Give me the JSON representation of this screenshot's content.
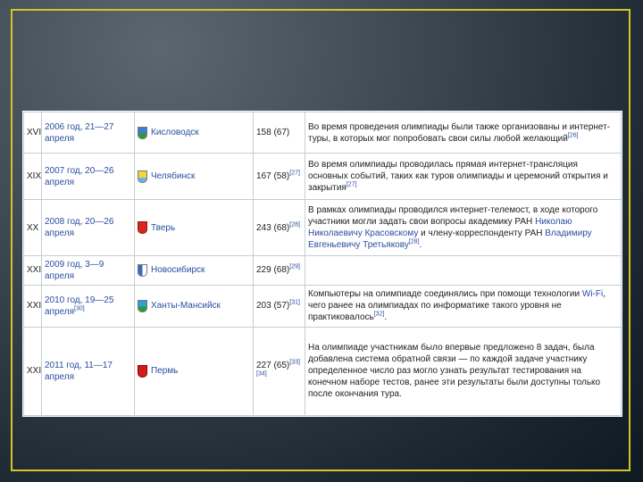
{
  "rows": [
    {
      "num": "XVII",
      "date": "2006 год, 21—27 апреля",
      "date_ref": "",
      "city": "Кисловодск",
      "crest_icon": "kislovodsk-crest-icon",
      "participants": "158 (67)",
      "participants_ref": "",
      "note_parts": [
        {
          "t": "Во время проведения олимпиады были также организованы и интернет-туры, в которых мог попробовать свои силы любой желающий",
          "link": false
        },
        {
          "t": "[26]",
          "sup": true
        }
      ]
    },
    {
      "num": "XIX",
      "date": "2007 год, 20—26 апреля",
      "date_ref": "",
      "city": "Челябинск",
      "crest_icon": "chelyabinsk-crest-icon",
      "participants": "167 (58)",
      "participants_ref": "[27]",
      "note_parts": [
        {
          "t": "Во время олимпиады проводилась прямая интернет-трансляция основных событий, таких как туров олимпиады и церемоний открытия и закрытия",
          "link": false
        },
        {
          "t": "[27]",
          "sup": true
        }
      ]
    },
    {
      "num": "XX",
      "date": "2008 год, 20—26 апреля",
      "date_ref": "",
      "city": "Тверь",
      "crest_icon": "tver-crest-icon",
      "participants": "243 (68)",
      "participants_ref": "[28]",
      "note_parts": [
        {
          "t": "В рамках олимпиады проводился интернет-телемост, в ходе которого участники могли задать свои вопросы академику РАН ",
          "link": false
        },
        {
          "t": "Николаю Николаевичу Красовскому",
          "link": true
        },
        {
          "t": " и члену-корреспонденту РАН ",
          "link": false
        },
        {
          "t": "Владимиру Евгеньевичу Третьякову",
          "link": true
        },
        {
          "t": "[28]",
          "sup": true
        },
        {
          "t": ".",
          "link": false
        }
      ]
    },
    {
      "num": "XXI",
      "date": "2009 год, 3—9 апреля",
      "date_ref": "",
      "city": "Новосибирск",
      "crest_icon": "novosibirsk-crest-icon",
      "participants": "229 (68)",
      "participants_ref": "[29]",
      "note_parts": []
    },
    {
      "num": "XXII",
      "date": "2010 год, 19—25 апреля",
      "date_ref": "[30]",
      "city": "Ханты-Мансийск",
      "crest_icon": "khanty-mansiysk-crest-icon",
      "participants": "203 (57)",
      "participants_ref": "[31]",
      "note_parts": [
        {
          "t": "Компьютеры на олимпиаде соединялись при помощи технологии ",
          "link": false
        },
        {
          "t": "Wi-Fi",
          "link": true
        },
        {
          "t": ", чего ранее на олимпиадах по информатике такого уровня не практиковалось",
          "link": false
        },
        {
          "t": "[32]",
          "sup": true
        },
        {
          "t": ".",
          "link": false
        }
      ]
    },
    {
      "num": "XXIII",
      "date": "2011 год, 11—17 апреля",
      "date_ref": "",
      "city": "Пермь",
      "crest_icon": "perm-crest-icon",
      "participants": "227 (65)",
      "participants_ref": "[33][34]",
      "note_parts": [
        {
          "t": "На олимпиаде участникам было впервые предложено 8 задач, была добавлена система обратной связи — по каждой задаче участнику определенное число раз могло узнать результат тестирования на конечном наборе тестов, ранее эти результаты были доступны только после окончания тура.",
          "link": false
        }
      ]
    }
  ],
  "colors": {
    "frame": "#d8c22a",
    "link": "#2a4ea0"
  }
}
